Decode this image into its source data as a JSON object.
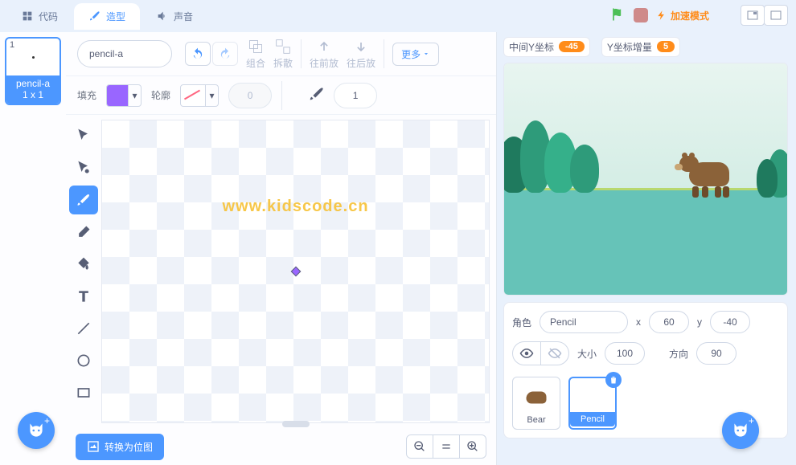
{
  "tabs": {
    "code": "代码",
    "costume": "造型",
    "sound": "声音"
  },
  "turbo": "加速模式",
  "costume": {
    "name": "pencil-a",
    "thumb_label": "pencil-a",
    "thumb_size": "1 x 1",
    "thumb_num": "1"
  },
  "groupBtns": {
    "group": "组合",
    "ungroup": "拆散",
    "front": "往前放",
    "back": "往后放",
    "more": "更多"
  },
  "fill": {
    "label": "填充",
    "outline": "轮廓",
    "outline_width": "0",
    "brush_size": "1"
  },
  "bitmap": "转换为位图",
  "watermark": "www.kidscode.cn",
  "monitors": {
    "m1_label": "中间Y坐标",
    "m1_val": "-45",
    "m2_label": "Y坐标增量",
    "m2_val": "5"
  },
  "sprite": {
    "label": "角色",
    "name": "Pencil",
    "x_label": "x",
    "x": "60",
    "y_label": "y",
    "y": "-40",
    "size_label": "大小",
    "size": "100",
    "dir_label": "方向",
    "dir": "90"
  },
  "sprites": {
    "bear": "Bear",
    "pencil": "Pencil"
  }
}
